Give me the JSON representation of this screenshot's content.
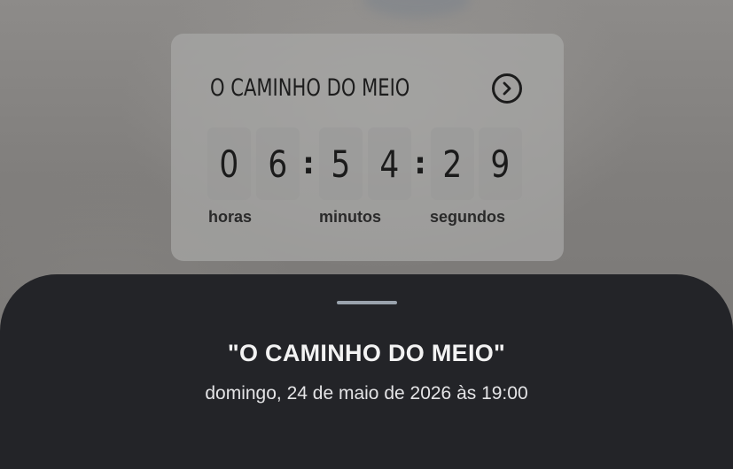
{
  "card": {
    "title": "O CAMINHO DO MEIO",
    "digits": [
      "0",
      "6",
      "5",
      "4",
      "2",
      "9"
    ],
    "separator": ":",
    "units": {
      "hours": "horas",
      "minutes": "minutos",
      "seconds": "segundos"
    },
    "action_icon": "chevron-right-circle-icon"
  },
  "sheet": {
    "title": "\"O CAMINHO DO MEIO\"",
    "date": "domingo, 24 de maio de 2026 às 19:00"
  },
  "colors": {
    "sheet_background": "#232428",
    "card_background": "#a8a7a6",
    "handle": "#9aa3ad"
  }
}
